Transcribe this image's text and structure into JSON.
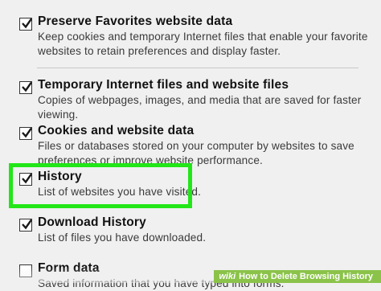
{
  "options": [
    {
      "title": "Preserve Favorites website data",
      "checked": true,
      "description": "Keep cookies and temporary Internet files that enable your favorite websites to retain preferences and display faster."
    },
    {
      "title": "Temporary Internet files and website files",
      "checked": true,
      "description": "Copies of webpages, images, and media that are saved for faster viewing."
    },
    {
      "title": "Cookies and website data",
      "checked": true,
      "description": "Files or databases stored on your computer by websites to save preferences or improve website performance."
    },
    {
      "title": "History",
      "checked": true,
      "description": "List of websites you have visited."
    },
    {
      "title": "Download History",
      "checked": true,
      "description": "List of files you have downloaded."
    },
    {
      "title": "Form data",
      "checked": false,
      "description": "Saved information that you have typed into forms."
    }
  ],
  "highlight_color": "#22e617",
  "watermark": {
    "brand": "wiki",
    "text": "How to Delete Browsing History"
  }
}
